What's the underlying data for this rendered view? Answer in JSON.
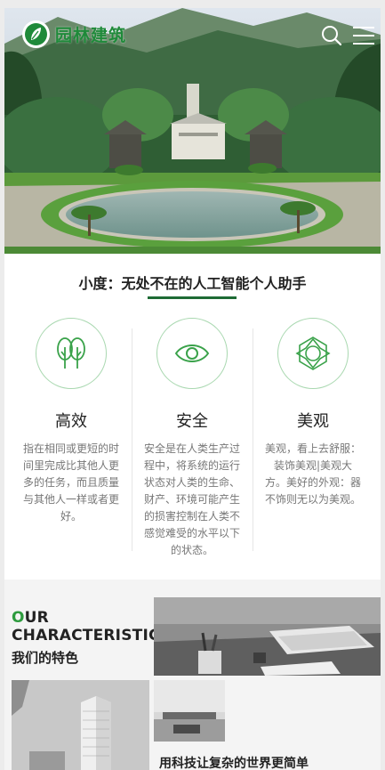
{
  "header": {
    "logo_text": "园林建筑",
    "icons": {
      "logo": "leaf-logo-icon",
      "search": "search-icon",
      "menu": "menu-icon"
    }
  },
  "slogan": "小度：无处不在的人工智能个人助手",
  "features": [
    {
      "icon": "trees-icon",
      "title": "高效",
      "desc": "指在相同或更短的时间里完成比其他人更多的任务，而且质量与其他人一样或者更好。"
    },
    {
      "icon": "eye-icon",
      "title": "安全",
      "desc": "安全是在人类生产过程中，将系统的运行状态对人类的生命、财产、环境可能产生的损害控制在人类不感觉难受的水平以下的状态。"
    },
    {
      "icon": "star-polygon-icon",
      "title": "美观",
      "desc": "美观，看上去舒服：装饰美观|美观大方。美好的外观：器不饰则无以为美观。"
    }
  ],
  "characteristic": {
    "title_first_letter": "O",
    "title_line1_rest": "UR",
    "title_line2": "CHARACTERISTIC",
    "subtitle": "我们的特色",
    "bottom_title": "用科技让复杂的世界更简单"
  },
  "colors": {
    "accent": "#2d9b3e",
    "divider": "#1e6b35",
    "text_muted": "#777777"
  }
}
